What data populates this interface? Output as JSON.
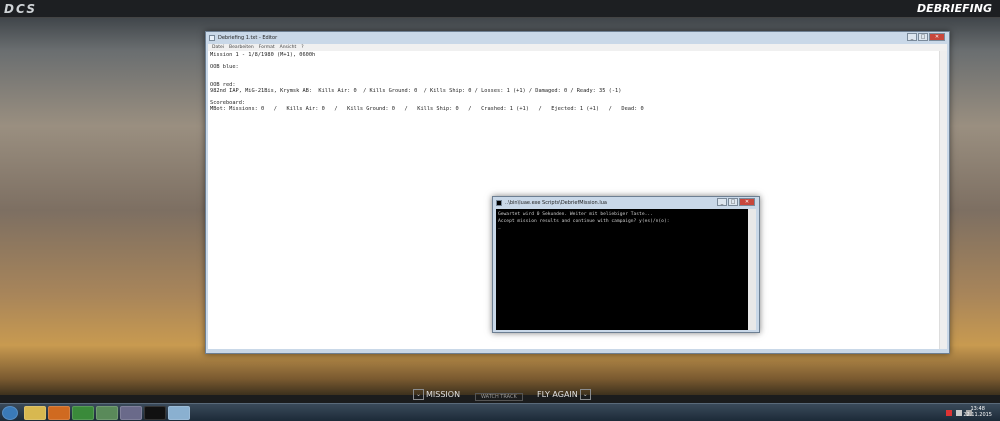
{
  "app": {
    "logo": "DCS",
    "screen_title": "DEBRIEFING"
  },
  "notepad": {
    "title": "Debriefing 1.txt - Editor",
    "menu": [
      "Datei",
      "Bearbeiten",
      "Format",
      "Ansicht",
      "?"
    ],
    "lines": [
      "Mission 1 - 1/8/1980 (M+1), 0600h",
      "",
      "OOB blue:",
      "",
      "",
      "OOB red:",
      "982nd IAP, MiG-21Bis, Krymsk AB:  Kills Air: 0  / Kills Ground: 0  / Kills Ship: 0 / Losses: 1 (+1) / Damaged: 0 / Ready: 35 (-1)",
      "",
      "Scoreboard:",
      "MBot: Missions: 0   /   Kills Air: 0   /   Kills Ground: 0   /   Kills Ship: 0   /   Crashed: 1 (+1)   /   Ejected: 1 (+1)   /   Dead: 0"
    ]
  },
  "console": {
    "title": "..\\bin\\luae.exe  Scripts\\DebriefMission.lua",
    "lines": [
      "Gewartet wird 0 Sekunden. Weiter mit beliebiger Taste...",
      "Accept mission results and continue with campaign? y(es)/n(o):",
      "_"
    ]
  },
  "bottom": {
    "mission_editor": "MISSION",
    "watch_track": "WATCH TRACK",
    "fly_again": "FLY AGAIN"
  },
  "taskbar": {
    "time": "13:48",
    "date": "22.11.2015"
  }
}
